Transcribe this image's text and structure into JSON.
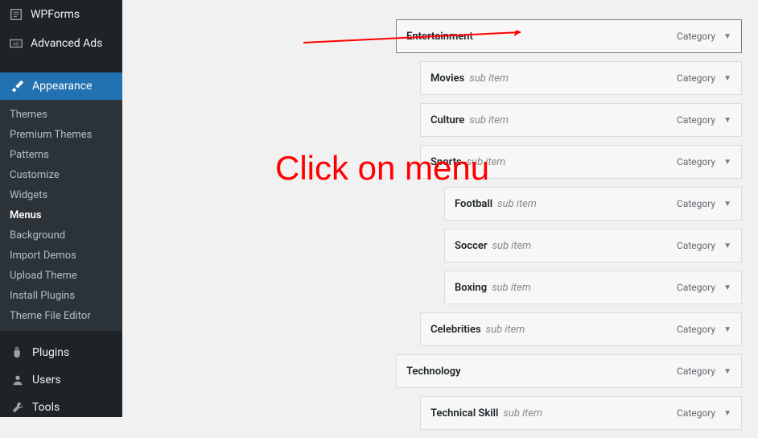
{
  "sidebar": {
    "top_items": [
      {
        "label": "WPForms",
        "icon": "wpforms-icon"
      },
      {
        "label": "Advanced Ads",
        "icon": "ads-icon"
      }
    ],
    "appearance": {
      "label": "Appearance",
      "submenu": [
        {
          "label": "Themes"
        },
        {
          "label": "Premium Themes"
        },
        {
          "label": "Patterns"
        },
        {
          "label": "Customize"
        },
        {
          "label": "Widgets"
        },
        {
          "label": "Menus",
          "current": true
        },
        {
          "label": "Background"
        },
        {
          "label": "Import Demos"
        },
        {
          "label": "Upload Theme"
        },
        {
          "label": "Install Plugins"
        },
        {
          "label": "Theme File Editor"
        }
      ]
    },
    "bottom_items": [
      {
        "label": "Plugins",
        "icon": "plugin-icon"
      },
      {
        "label": "Users",
        "icon": "users-icon"
      },
      {
        "label": "Tools",
        "icon": "tools-icon"
      }
    ]
  },
  "menu_items": [
    {
      "title": "Entertainment",
      "sub": false,
      "type": "Category",
      "depth": 0,
      "selected": true
    },
    {
      "title": "Movies",
      "sub": true,
      "type": "Category",
      "depth": 1
    },
    {
      "title": "Culture",
      "sub": true,
      "type": "Category",
      "depth": 1
    },
    {
      "title": "Sports",
      "sub": true,
      "type": "Category",
      "depth": 1
    },
    {
      "title": "Football",
      "sub": true,
      "type": "Category",
      "depth": 2
    },
    {
      "title": "Soccer",
      "sub": true,
      "type": "Category",
      "depth": 2
    },
    {
      "title": "Boxing",
      "sub": true,
      "type": "Category",
      "depth": 2
    },
    {
      "title": "Celebrities",
      "sub": true,
      "type": "Category",
      "depth": 1
    },
    {
      "title": "Technology",
      "sub": false,
      "type": "Category",
      "depth": 0
    },
    {
      "title": "Technical Skill",
      "sub": true,
      "type": "Category",
      "depth": 1
    }
  ],
  "labels": {
    "sub_item": "sub item"
  },
  "annotation": {
    "text": "Click on menu"
  }
}
